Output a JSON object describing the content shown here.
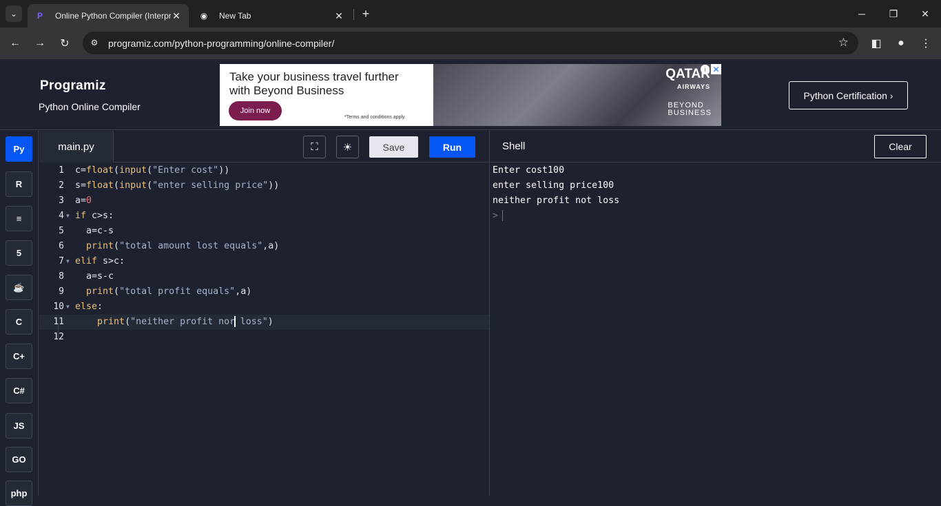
{
  "browser": {
    "tabs": [
      {
        "title": "Online Python Compiler (Interpreter)",
        "active": true
      },
      {
        "title": "New Tab",
        "active": false
      }
    ],
    "url": "programiz.com/python-programming/online-compiler/"
  },
  "header": {
    "logo": "Programiz",
    "subtitle": "Python Online Compiler",
    "certification_button": "Python Certification ›"
  },
  "ad": {
    "headline_1": "Take your business travel further",
    "headline_2": "with Beyond Business",
    "cta": "Join now",
    "terms": "*Terms and conditions apply.",
    "brand": "QATAR",
    "brand_sub": "AIRWAYS",
    "tagline_1": "BEYOND",
    "tagline_2": "BUSINESS"
  },
  "languages": [
    {
      "name": "python",
      "label": "🐍",
      "active": true
    },
    {
      "name": "r",
      "label": "R"
    },
    {
      "name": "sql",
      "label": "≡"
    },
    {
      "name": "html",
      "label": "5"
    },
    {
      "name": "java",
      "label": "☕"
    },
    {
      "name": "c",
      "label": "C"
    },
    {
      "name": "cpp",
      "label": "C+"
    },
    {
      "name": "csharp",
      "label": "C#"
    },
    {
      "name": "javascript",
      "label": "JS"
    },
    {
      "name": "go",
      "label": "GO"
    },
    {
      "name": "php",
      "label": "php"
    }
  ],
  "editor": {
    "filename": "main.py",
    "save_label": "Save",
    "run_label": "Run",
    "line_numbers": [
      "1",
      "2",
      "3",
      "4",
      "5",
      "6",
      "7",
      "8",
      "9",
      "10",
      "11",
      "12"
    ]
  },
  "shell": {
    "title": "Shell",
    "clear_label": "Clear",
    "output": [
      "Enter cost100",
      "enter selling price100",
      "neither profit not loss"
    ],
    "prompt": ">"
  }
}
